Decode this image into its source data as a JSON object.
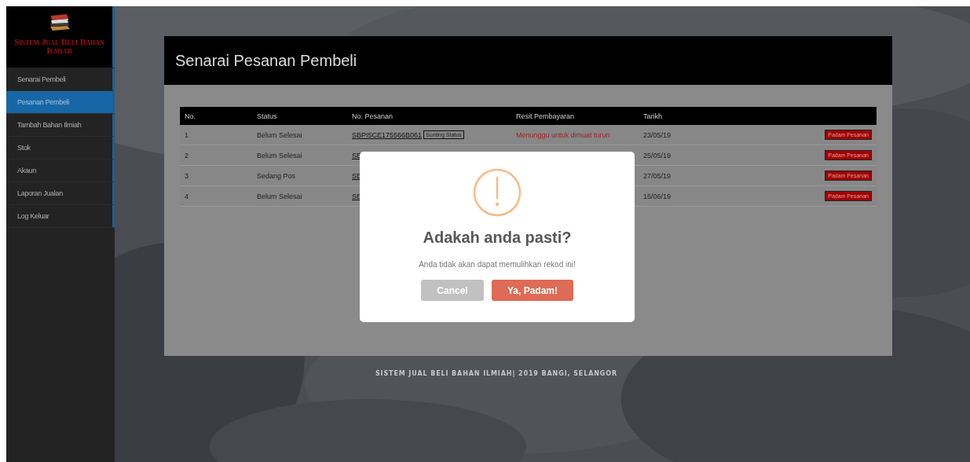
{
  "sidebar": {
    "logo_text": "Sistem Jual Beli Bahan Ilmiah",
    "items": [
      {
        "label": "Senarai Pembeli",
        "selected": false
      },
      {
        "label": "Pesanan Pembeli",
        "selected": true
      },
      {
        "label": "Tambah Bahan Ilmiah",
        "selected": false
      },
      {
        "label": "Stok",
        "selected": false
      },
      {
        "label": "Akaun",
        "selected": false
      },
      {
        "label": "Laporan Jualan",
        "selected": false
      },
      {
        "label": "Log Keluar",
        "selected": false
      }
    ]
  },
  "panel": {
    "title": "Senarai Pesanan Pembeli",
    "table": {
      "columns": [
        "No.",
        "Status",
        "No. Pesanan",
        "Resit Pembayaran",
        "Tarikh"
      ],
      "rows": [
        {
          "no": "1",
          "status": "Belum Selesai",
          "order_no": "SBPI5CE175566B061",
          "edit_button": "Sunting Status",
          "receipt": "Menunggu untuk dimuat turun",
          "date": "23/05/19",
          "delete_button": "Padam Pesanan"
        },
        {
          "no": "2",
          "status": "Belum Selesai",
          "order_no": "SE",
          "date": "25/05/19",
          "delete_button": "Padam Pesanan"
        },
        {
          "no": "3",
          "status": "Sedang Pos",
          "order_no": "SE",
          "date": "27/05/19",
          "delete_button": "Padam Pesanan"
        },
        {
          "no": "4",
          "status": "Belum Selesai",
          "order_no": "SE",
          "date": "15/06/19",
          "delete_button": "Padam Pesanan"
        }
      ]
    }
  },
  "footer": "SISTEM JUAL BELI BAHAN ILMIAH| 2019 BANGI, SELANGOR",
  "dialog": {
    "title": "Adakah anda pasti?",
    "message": "Anda tidak akan dapat memulihkan rekod ini!",
    "buttons": [
      {
        "label": "Cancel",
        "kind": "cancel"
      },
      {
        "label": "Ya, Padam!",
        "kind": "confirm"
      }
    ]
  }
}
